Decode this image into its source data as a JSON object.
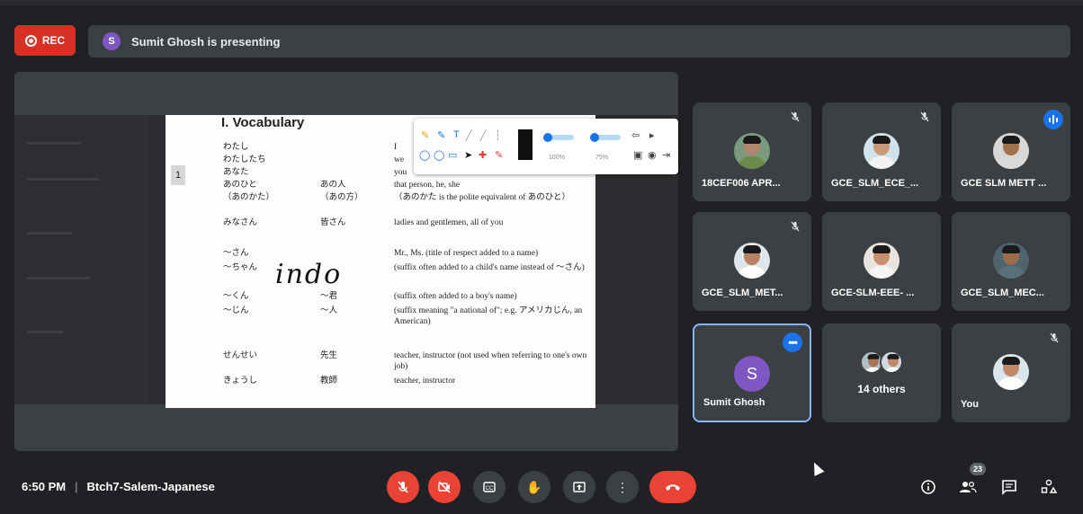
{
  "recording": {
    "label": "REC"
  },
  "presenter_banner": {
    "initial": "S",
    "text": "Sumit Ghosh is presenting"
  },
  "document": {
    "page_number": "1",
    "section_title": "I.  Vocabulary",
    "rows": [
      {
        "jp": "わたし",
        "kanji": "",
        "en": "I"
      },
      {
        "jp": "わたしたち",
        "kanji": "",
        "en": "we"
      },
      {
        "jp": "あなた",
        "kanji": "",
        "en": "you"
      },
      {
        "jp": "あのひと",
        "kanji": "あの人",
        "en": "that person, he, she"
      },
      {
        "jp": "（あのかた）",
        "kanji": "（あの方）",
        "en": "（あのかた is the polite equivalent of あのひと）"
      },
      {
        "jp": "みなさん",
        "kanji": "皆さん",
        "en": "ladies and gentlemen, all of you"
      },
      {
        "jp": "～さん",
        "kanji": "",
        "en": "Mr., Ms. (title of respect added to a name)"
      },
      {
        "jp": "～ちゃん",
        "kanji": "",
        "en": "(suffix often added to a child's name instead of ～さん)"
      },
      {
        "jp": "～くん",
        "kanji": "～君",
        "en": "(suffix often added to a boy's name)"
      },
      {
        "jp": "～じん",
        "kanji": "～人",
        "en": "(suffix meaning \"a national of\"; e.g. アメリカじん, an American)"
      },
      {
        "jp": "せんせい",
        "kanji": "先生",
        "en": "teacher, instructor (not used when referring to one's own job)"
      },
      {
        "jp": "きょうし",
        "kanji": "教師",
        "en": "teacher, instructor"
      }
    ],
    "handwriting": "indo"
  },
  "annotation_toolbar": {
    "opacity_label": "100%",
    "size_label": "75%"
  },
  "participants": [
    {
      "name": "18CEF006 APR...",
      "muted": true
    },
    {
      "name": "GCE_SLM_ECE_...",
      "muted": true
    },
    {
      "name": "GCE SLM METT ...",
      "speaking": true
    },
    {
      "name": "GCE_SLM_MET...",
      "muted": true
    },
    {
      "name": "GCE-SLM-EEE- ...",
      "muted": false
    },
    {
      "name": "GCE_SLM_MEC...",
      "muted": false
    },
    {
      "name": "Sumit Ghosh",
      "initial": "S",
      "active": true
    },
    {
      "name": "14 others"
    },
    {
      "name": "You",
      "muted": true
    }
  ],
  "bottom": {
    "time": "6:50 PM",
    "meeting_name": "Btch7-Salem-Japanese",
    "participant_count": "23"
  },
  "icons": {
    "mic_off": "mic-off-icon",
    "cam_off": "camera-off-icon",
    "captions": "captions-icon",
    "raise_hand": "raise-hand-icon",
    "present": "present-icon",
    "more": "more-options-icon",
    "leave": "leave-call-icon",
    "info": "info-icon",
    "people": "people-icon",
    "chat": "chat-icon",
    "activities": "activities-icon"
  },
  "colors": {
    "rec": "#d93025",
    "accent": "#1a73e8",
    "leave": "#ea4335",
    "avatar_purple": "#7e57c2"
  }
}
